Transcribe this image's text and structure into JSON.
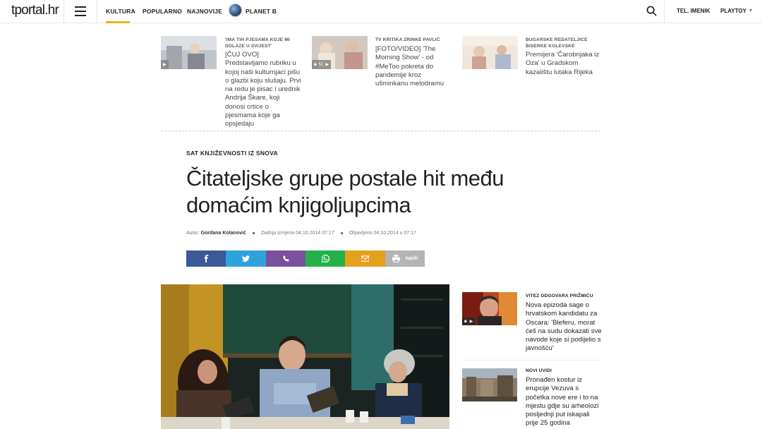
{
  "header": {
    "logo_main": "tportal",
    "logo_suffix": ".hr",
    "nav": [
      {
        "label": "KULTURA",
        "active": true
      },
      {
        "label": "POPULARNO",
        "active": false
      },
      {
        "label": "NAJNOVIJE",
        "active": false
      },
      {
        "label": "PLANET B",
        "active": false
      }
    ],
    "right_links": [
      "TEL. IMENIK",
      "PLAYTOY"
    ],
    "accent_color": "#f3b21b"
  },
  "related": [
    {
      "kicker": "'IMA TIH PJESAMA KOJE MI DOLAZE U SVIJEST'",
      "title": "[ČUJ OVO] Predstavljamo rubriku u kojoj naši kulturnjaci pišu o glazbi koju slušaju. Prvi na redu je pisac i urednik Andrija Škare, koji donosi crtice o pjesmama koje ga opsjedaju",
      "badge_icon": "play-icon",
      "badge_count": ""
    },
    {
      "kicker": "TV KRITIKA ZRINKE PAVLIĆ",
      "title": "[FOTO/VIDEO] 'The Morning Show' - od #MeToo pokreta do pandemije kroz ušminkanu melodramu",
      "badge_icon": "camera-icon",
      "badge_count": "51"
    },
    {
      "kicker": "BUGARSKE REDATELJICE BISERKE KOLEVSKE",
      "title": "Premijera 'Čarobnjaka iz Oza' u Gradskom kazalištu lutaka Rijeka",
      "badge_icon": "",
      "badge_count": ""
    }
  ],
  "article": {
    "kicker": "SAT KNJIŽEVNOSTI IZ SNOVA",
    "headline": "Čitateljske grupe postale hit među domaćim knjigoljupcima",
    "author_label": "Autor:",
    "author": "Gordana Kolanović",
    "updated": "Zadnja izmjena 04.10.2014 07:17",
    "published": "Objavljeno 04.10.2014 u 07:17"
  },
  "share": [
    {
      "name": "facebook",
      "color": "#3b5998",
      "label": ""
    },
    {
      "name": "twitter",
      "color": "#2fa2de",
      "label": ""
    },
    {
      "name": "viber",
      "color": "#7b519d",
      "label": ""
    },
    {
      "name": "whatsapp",
      "color": "#25b14a",
      "label": ""
    },
    {
      "name": "email",
      "color": "#e5a11b",
      "label": ""
    },
    {
      "name": "print",
      "color": "#b4b4b4",
      "label": "Ispiši"
    }
  ],
  "sidebar": [
    {
      "kicker": "VITEZ ODGOVARA PRIŽMIĆU",
      "title": "Nova epizoda sage o hrvatskom kandidatu za Oscara: 'Bleferu, morat ćeš na sudu dokazati sve navode koje si podijelio s javnošću'",
      "badge_icons": [
        "camera-icon",
        "play-icon"
      ]
    },
    {
      "kicker": "NOVI UVIDI",
      "title": "Pronađen kostur iz erupcije Vezuva s početka nove ere i to na mjestu gdje su arheolozi posljednji put iskapali prije 25 godina",
      "badge_icons": []
    }
  ]
}
